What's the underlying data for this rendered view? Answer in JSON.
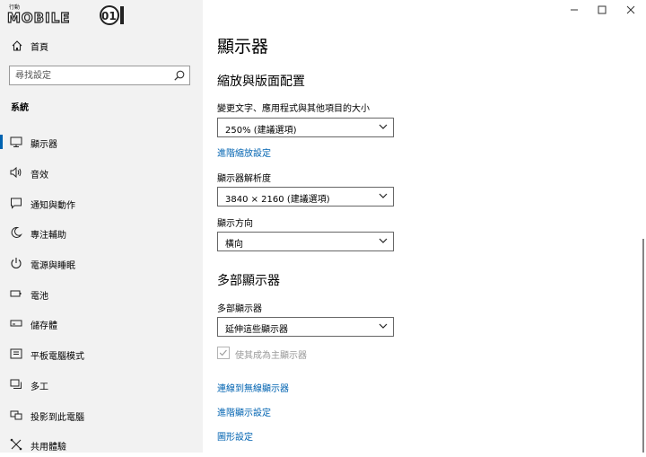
{
  "logo": {
    "small_text": "行動",
    "brand": "MOBILE",
    "number": "01"
  },
  "sidebar": {
    "home_label": "首頁",
    "search_placeholder": "尋找設定",
    "section": "系統",
    "items": [
      {
        "label": "顯示器",
        "icon": "monitor-icon",
        "active": true
      },
      {
        "label": "音效",
        "icon": "speaker-icon"
      },
      {
        "label": "通知與動作",
        "icon": "notification-icon"
      },
      {
        "label": "專注輔助",
        "icon": "moon-icon"
      },
      {
        "label": "電源與睡眠",
        "icon": "power-icon"
      },
      {
        "label": "電池",
        "icon": "battery-icon"
      },
      {
        "label": "儲存體",
        "icon": "storage-icon"
      },
      {
        "label": "平板電腦模式",
        "icon": "tablet-icon"
      },
      {
        "label": "多工",
        "icon": "multitask-icon"
      },
      {
        "label": "投影到此電腦",
        "icon": "project-icon"
      },
      {
        "label": "共用體驗",
        "icon": "shared-experience-icon"
      }
    ]
  },
  "main": {
    "title": "顯示器",
    "scale_section": {
      "heading": "縮放與版面配置",
      "size_label": "變更文字、應用程式與其他項目的大小",
      "size_value": "250% (建議選項)",
      "advanced_link": "進階縮放設定",
      "resolution_label": "顯示器解析度",
      "resolution_value": "3840 × 2160 (建議選項)",
      "orientation_label": "顯示方向",
      "orientation_value": "橫向"
    },
    "multi_section": {
      "heading": "多部顯示器",
      "multi_label": "多部顯示器",
      "multi_value": "延伸這些顯示器",
      "main_display_label": "使其成為主顯示器",
      "main_display_checked": true,
      "wireless_link": "連線到無線顯示器",
      "advanced_display_link": "進階顯示設定",
      "graphics_link": "圖形設定"
    }
  },
  "colors": {
    "accent": "#0063b1",
    "sidebar_bg": "#f2f2f2",
    "disabled": "#999999"
  }
}
